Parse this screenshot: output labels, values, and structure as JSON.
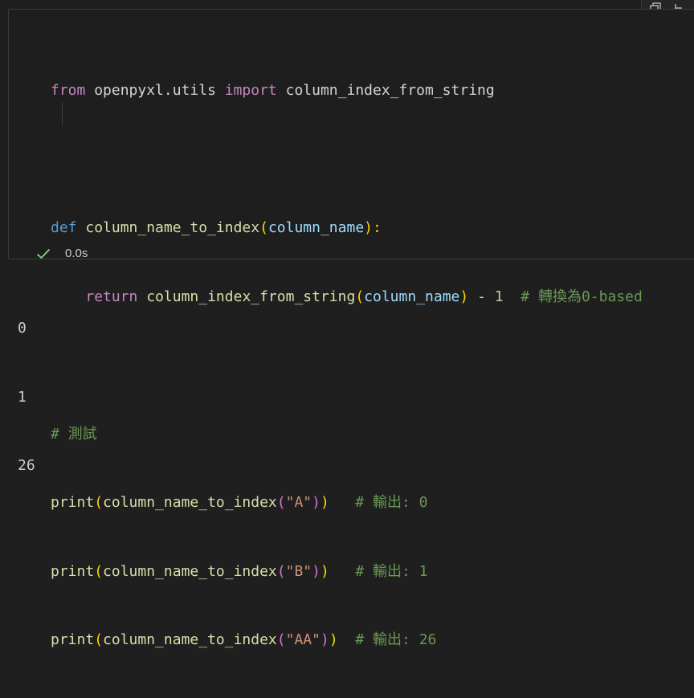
{
  "cell": {
    "code_lines": [
      [
        "from",
        " openpyxl.utils ",
        "import",
        " column_index_from_string"
      ],
      [],
      [
        "def",
        " ",
        "column_name_to_index",
        "(",
        "column_name",
        "):"
      ],
      [
        "return",
        " ",
        "column_index_from_string",
        "(",
        "column_name",
        ")",
        " - ",
        "1",
        "  # 轉換為0-based"
      ],
      [],
      [
        "# 測試"
      ],
      [
        "print",
        "(",
        "column_name_to_index",
        "(",
        "\"A\"",
        ")",
        ")",
        "   # 輸出: 0"
      ],
      [
        "print",
        "(",
        "column_name_to_index",
        "(",
        "\"B\"",
        ")",
        ")",
        "   # 輸出: 1"
      ],
      [
        "print",
        "(",
        "column_name_to_index",
        "(",
        "\"AA\"",
        ")",
        ")",
        "  # 輸出: 26"
      ]
    ],
    "status": {
      "icon": "check-icon",
      "duration": "0.0s"
    }
  },
  "output": {
    "lines": [
      "0",
      "1",
      "26"
    ]
  },
  "toolbar": {
    "icons": [
      "copy-icon",
      "split-icon"
    ]
  },
  "colors": {
    "keyword": "#c586c0",
    "def": "#569cd6",
    "function": "#dcdcaa",
    "variable": "#9cdcfe",
    "string": "#ce9178",
    "number": "#b5cea8",
    "comment": "#6a9955",
    "success": "#89d185"
  }
}
